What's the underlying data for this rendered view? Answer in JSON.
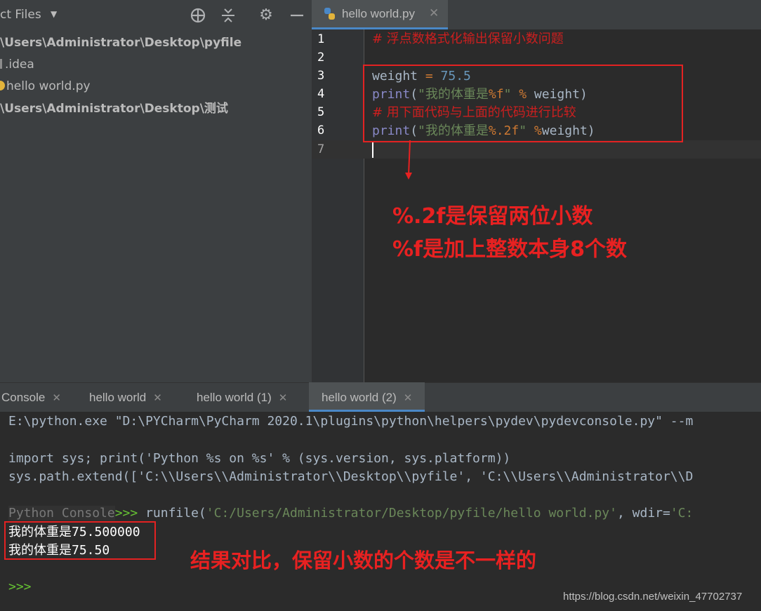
{
  "project": {
    "header_title": "ct Files",
    "tree": [
      {
        "label": "\\Users\\Administrator\\Desktop\\pyfile",
        "bold": true
      },
      {
        "label": ".idea",
        "bold": false
      },
      {
        "label": "hello world.py",
        "bold": false
      },
      {
        "label": "\\Users\\Administrator\\Desktop\\测试",
        "bold": true
      }
    ]
  },
  "editor": {
    "tab_label": "hello world.py",
    "line_numbers": [
      "1",
      "2",
      "3",
      "4",
      "5",
      "6",
      "7"
    ],
    "lines": {
      "l1": "# 浮点数格式化输出保留小数问题",
      "l3_var": "weight",
      "l3_op": " = ",
      "l3_num": "75.5",
      "l4_fn": "print",
      "l4_open": "(",
      "l4_str1": "\"我的体重是",
      "l4_fmt": "%f",
      "l4_str2": "\"",
      "l4_op": " % ",
      "l4_rest": "weight)",
      "l5": "# 用下面代码与上面的代码进行比较",
      "l6_fn": "print",
      "l6_open": "(",
      "l6_str1": "\"我的体重是",
      "l6_fmt": "%.2f",
      "l6_str2": "\"",
      "l6_op": " %",
      "l6_rest": "weight)"
    },
    "annotation_1": "%.2f是保留两位小数",
    "annotation_2": "%f是加上整数本身8个数"
  },
  "console": {
    "tabs": [
      {
        "label": "Console",
        "active": false
      },
      {
        "label": "hello world",
        "active": false
      },
      {
        "label": "hello world (1)",
        "active": false
      },
      {
        "label": "hello world (2)",
        "active": true
      }
    ],
    "line1": "E:\\python.exe \"D:\\PYCharm\\PyCharm 2020.1\\plugins\\python\\helpers\\pydev\\pydevconsole.py\" --m",
    "line2": "import sys; print('Python %s on %s' % (sys.version, sys.platform))",
    "line3": "sys.path.extend(['C:\\\\Users\\\\Administrator\\\\Desktop\\\\pyfile', 'C:\\\\Users\\\\Administrator\\\\D",
    "prompt_label": "Python Console",
    "prompt": ">>> ",
    "run_cmd": "runfile(",
    "run_arg": "'C:/Users/Administrator/Desktop/pyfile/hello world.py'",
    "run_rest": ", wdir=",
    "run_tail": "'C:",
    "out1_cn": "我的体重是",
    "out1_num": "75.500000",
    "out2_cn": "我的体重是",
    "out2_num": "75.50",
    "annotation": "结果对比，保留小数的个数是不一样的",
    "final_prompt": ">>>"
  },
  "watermark": "https://blog.csdn.net/weixin_47702737",
  "colors": {
    "annotation_red": "#e82121",
    "accent_blue": "#4a88c7",
    "background": "#2b2b2b"
  }
}
